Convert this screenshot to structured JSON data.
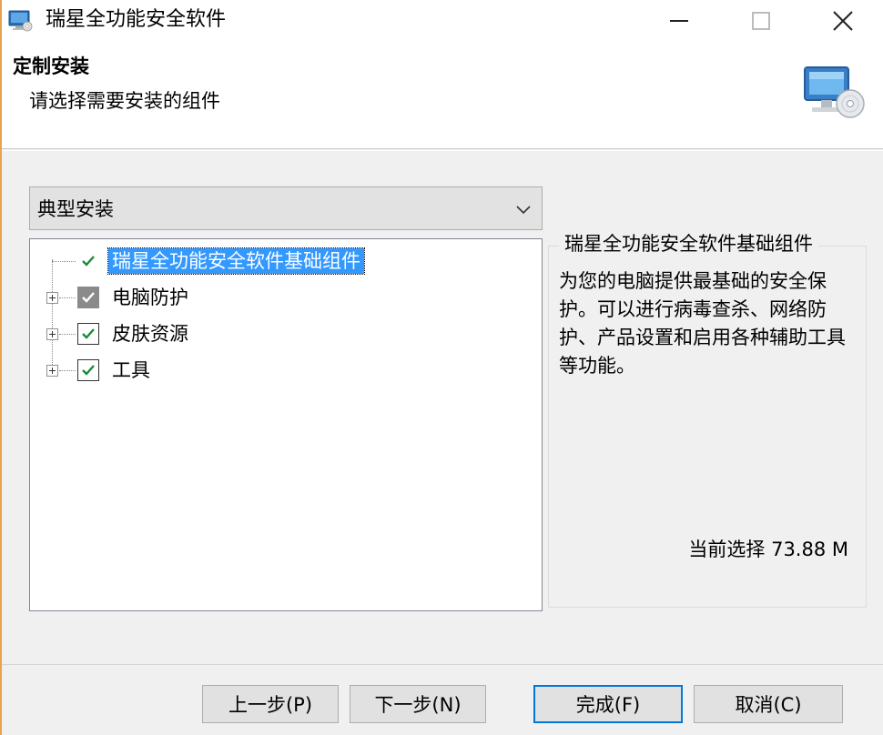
{
  "window": {
    "title": "瑞星全功能安全软件"
  },
  "header": {
    "title": "定制安装",
    "subtitle": "请选择需要安装的组件"
  },
  "install_type": {
    "selected": "典型安装"
  },
  "tree": {
    "items": [
      {
        "label": "瑞星全功能安全软件基础组件",
        "checked": true,
        "state": "checked",
        "selected": true,
        "expandable": false
      },
      {
        "label": "电脑防护",
        "checked": true,
        "state": "partial",
        "selected": false,
        "expandable": true
      },
      {
        "label": "皮肤资源",
        "checked": true,
        "state": "checked",
        "selected": false,
        "expandable": true
      },
      {
        "label": "工具",
        "checked": true,
        "state": "checked",
        "selected": false,
        "expandable": true
      }
    ]
  },
  "description": {
    "title": "瑞星全功能安全软件基础组件",
    "text": "为您的电脑提供最基础的安全保护。可以进行病毒查杀、网络防护、产品设置和启用各种辅助工具等功能。",
    "size_label": "当前选择 73.88 M"
  },
  "buttons": {
    "back": "上一步(P)",
    "next": "下一步(N)",
    "finish": "完成(F)",
    "cancel": "取消(C)"
  },
  "colors": {
    "selection": "#3399ff",
    "check_green": "#1a8a3a",
    "default_button_border": "#0078d7",
    "window_accent": "#e8a250"
  }
}
